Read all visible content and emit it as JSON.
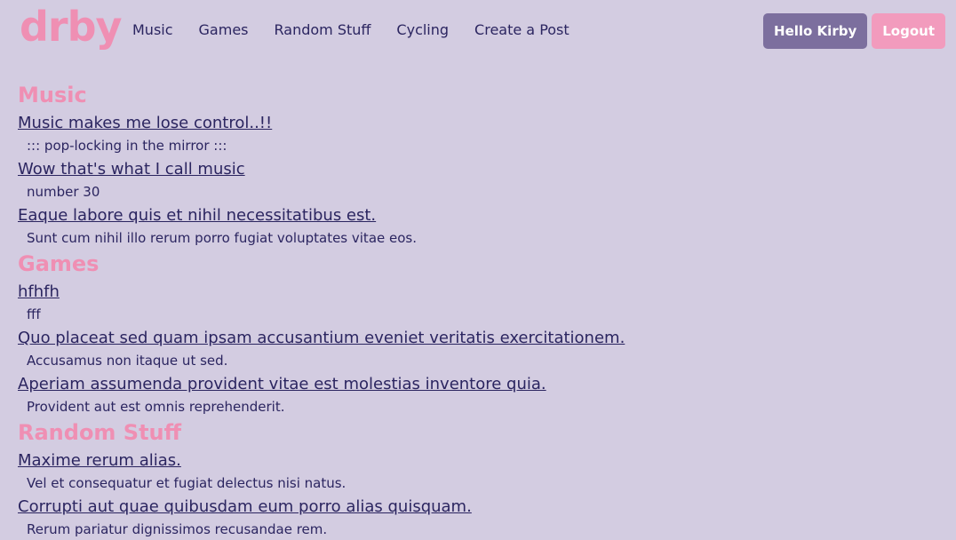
{
  "brand": {
    "logo": "drby"
  },
  "nav": {
    "links": [
      "Music",
      "Games",
      "Random Stuff",
      "Cycling",
      "Create a Post"
    ],
    "hello_label": "Hello Kirby",
    "logout_label": "Logout"
  },
  "colors": {
    "background": "#d3cce1",
    "accent_pink": "#ef8fb3",
    "text_dark": "#2b2560",
    "hello_button": "#7c6f9e",
    "logout_button": "#f29bbd"
  },
  "sections": [
    {
      "title": "Music",
      "posts": [
        {
          "title": "Music makes me lose control..!!",
          "body": "::: pop-locking in the mirror :::"
        },
        {
          "title": "Wow that's what I call music",
          "body": "number 30"
        },
        {
          "title": "Eaque labore quis et nihil necessitatibus est.",
          "body": "Sunt cum nihil illo rerum porro fugiat voluptates vitae eos."
        }
      ]
    },
    {
      "title": "Games",
      "posts": [
        {
          "title": "hfhfh",
          "body": "fff"
        },
        {
          "title": "Quo placeat sed quam ipsam accusantium eveniet veritatis exercitationem.",
          "body": "Accusamus non itaque ut sed."
        },
        {
          "title": "Aperiam assumenda provident vitae est molestias inventore quia.",
          "body": "Provident aut est omnis reprehenderit."
        }
      ]
    },
    {
      "title": "Random Stuff",
      "posts": [
        {
          "title": "Maxime rerum alias.",
          "body": "Vel et consequatur et fugiat delectus nisi natus."
        },
        {
          "title": "Corrupti aut quae quibusdam eum porro alias quisquam.",
          "body": "Rerum pariatur dignissimos recusandae rem."
        }
      ]
    }
  ]
}
